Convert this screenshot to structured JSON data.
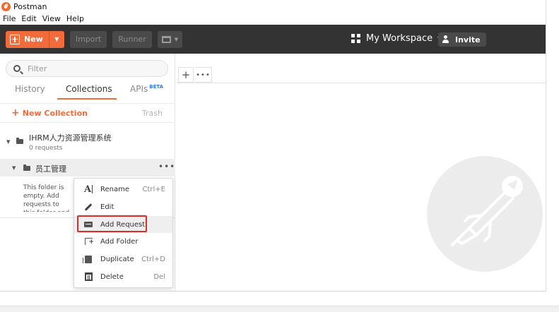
{
  "window": {
    "title": "Postman"
  },
  "menu": [
    "File",
    "Edit",
    "View",
    "Help"
  ],
  "toolbar": {
    "new_label": "New",
    "import_label": "Import",
    "runner_label": "Runner",
    "workspace_label": "My Workspace",
    "invite_label": "Invite"
  },
  "sidebar": {
    "filter_placeholder": "Filter",
    "tabs": {
      "history": "History",
      "collections": "Collections",
      "apis": "APIs",
      "apis_badge": "BETA"
    },
    "new_collection_label": "New Collection",
    "trash_label": "Trash",
    "collection": {
      "name": "IHRM人力资源管理系统",
      "requests": "0 requests"
    },
    "folder": {
      "name": "员工管理",
      "more": "•••",
      "empty_text": "This folder is empty. Add requests to this folder and create subfolders to organize them"
    }
  },
  "context_menu": {
    "items": [
      {
        "label": "Rename",
        "shortcut": "Ctrl+E",
        "icon": "rename-icon"
      },
      {
        "label": "Edit",
        "shortcut": "",
        "icon": "edit-icon"
      },
      {
        "label": "Add Request",
        "shortcut": "",
        "icon": "add-request-icon"
      },
      {
        "label": "Add Folder",
        "shortcut": "",
        "icon": "add-folder-icon"
      },
      {
        "label": "Duplicate",
        "shortcut": "Ctrl+D",
        "icon": "duplicate-icon"
      },
      {
        "label": "Delete",
        "shortcut": "Del",
        "icon": "delete-icon"
      }
    ]
  },
  "main": {
    "add_tab": "+",
    "more_tabs": "•••"
  },
  "colors": {
    "brand": "#f26b3a",
    "toolbar_bg": "#333333",
    "highlight": "#e02b2b",
    "beta": "#2f7ee6"
  }
}
